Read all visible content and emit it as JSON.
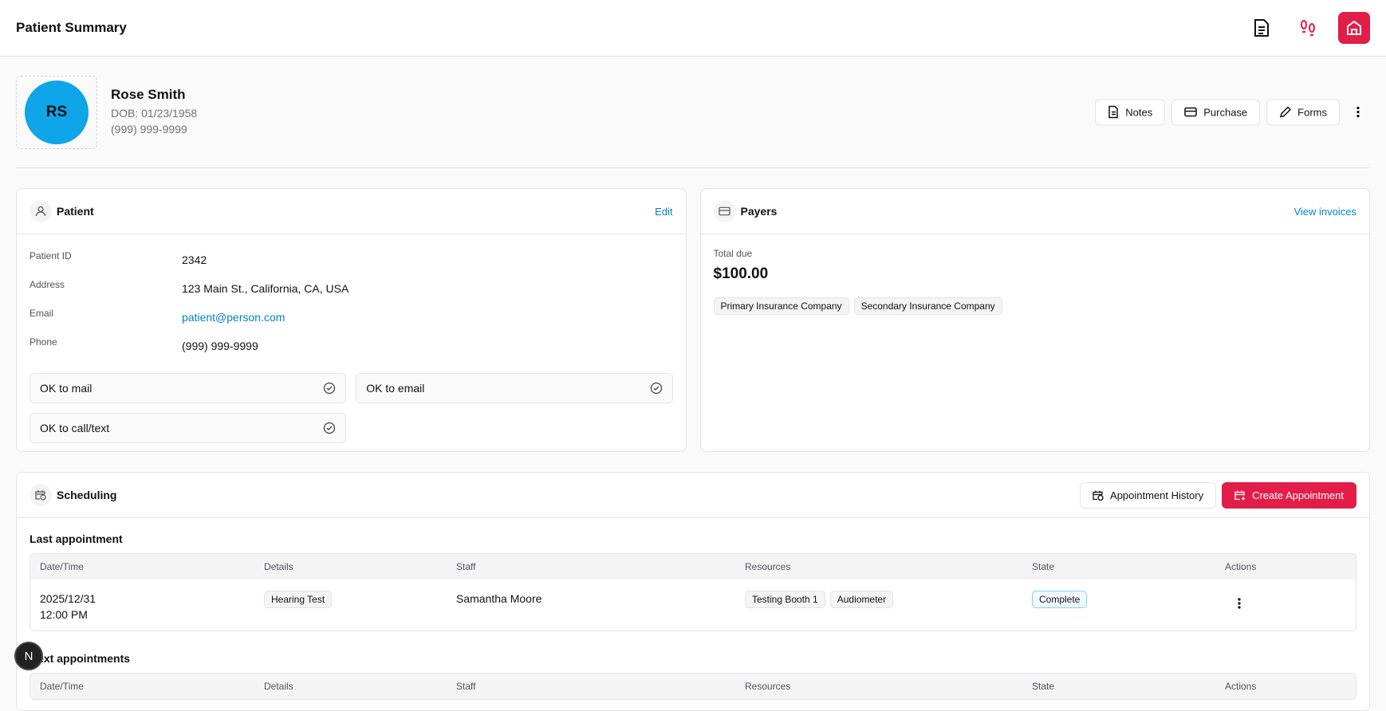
{
  "header": {
    "title": "Patient Summary",
    "icons": [
      "document-icon",
      "footprints-icon",
      "home-icon"
    ],
    "accent": "#e11d48"
  },
  "profile": {
    "initials": "RS",
    "name": "Rose Smith",
    "dob": "DOB: 01/23/1958",
    "phone": "(999) 999-9999",
    "actions": [
      "Notes",
      "Purchase",
      "Forms"
    ]
  },
  "patient": {
    "title": "Patient",
    "edit": "Edit",
    "fields": [
      {
        "k": "Patient ID",
        "v": "2342"
      },
      {
        "k": "Address",
        "v": "123 Main St., California, CA, USA"
      },
      {
        "k": "Email",
        "v": "patient@person.com"
      },
      {
        "k": "Phone",
        "v": "(999) 999-9999"
      }
    ],
    "checks": [
      "OK to mail",
      "OK to email",
      "OK to call/text"
    ]
  },
  "payers": {
    "title": "Payers",
    "link": "View invoices",
    "total_label": "Total due",
    "total": "$100.00",
    "tags": [
      "Primary Insurance Company",
      "Secondary Insurance Company"
    ]
  },
  "scheduling": {
    "title": "Scheduling",
    "history": "Appointment History",
    "create": "Create Appointment",
    "last_title": "Last appointment",
    "next_title": "Next appointments",
    "columns": [
      "Date/Time",
      "Details",
      "Staff",
      "Resources",
      "State",
      "Actions"
    ],
    "last": {
      "date": "2025/12/31",
      "time": "12:00 PM",
      "details": "Hearing Test",
      "staff": "Samantha Moore",
      "resources": [
        "Testing Booth 1",
        "Audiometer"
      ],
      "state": "Complete"
    }
  },
  "badge": "N"
}
